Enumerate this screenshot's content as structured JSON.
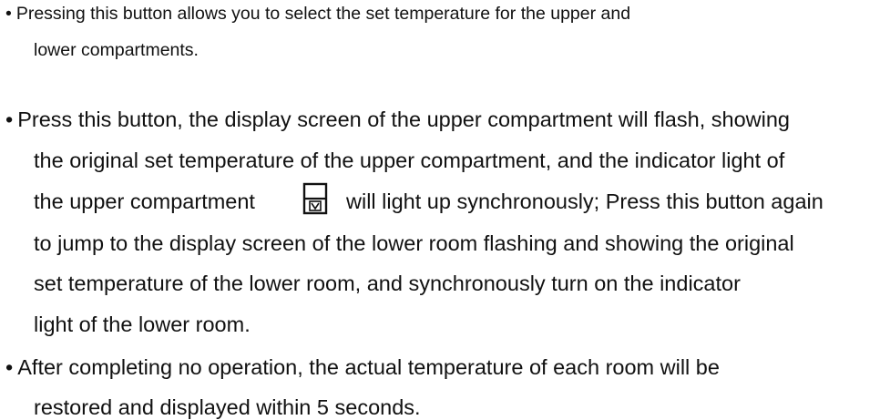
{
  "bullet_symbol": "•",
  "para1": {
    "line1": "Pressing this button allows you to select the set temperature for the upper and",
    "line2": "lower compartments."
  },
  "para2": {
    "line1": "Press this button, the display screen of the upper compartment will flash, showing",
    "line2": "the original set temperature of the upper compartment, and the indicator light of",
    "line3_before_icon": "the upper compartment",
    "line3_after_icon": "will light up synchronously; Press this button again",
    "line4": "to jump to the display screen of the lower room flashing and showing the original",
    "line5": "set temperature of the lower room, and synchronously turn on the indicator",
    "line6": "light of the lower room."
  },
  "para3": {
    "line1": "After completing no operation, the actual temperature of each room will be",
    "line2": "restored and displayed within 5 seconds."
  },
  "icons": {
    "upper_compartment_indicator": "upper-compartment-indicator-icon"
  }
}
